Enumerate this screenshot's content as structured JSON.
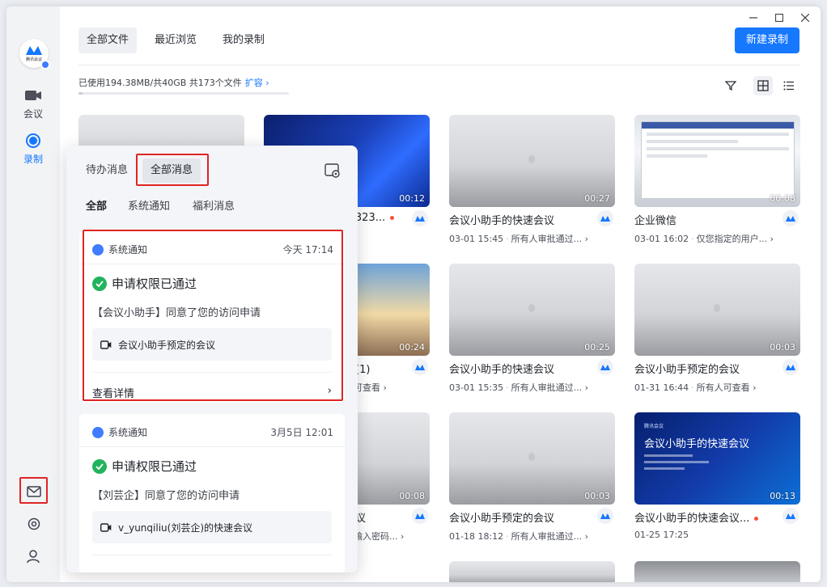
{
  "app": {
    "logo_text": "腾讯会议",
    "brand_color": "#1677ff"
  },
  "sidebar": {
    "items": [
      {
        "label": "会议",
        "icon": "camera-icon"
      },
      {
        "label": "录制",
        "icon": "record-icon"
      }
    ],
    "bottom": [
      {
        "icon": "mail-icon"
      },
      {
        "icon": "settings-icon"
      },
      {
        "icon": "user-icon"
      }
    ]
  },
  "header": {
    "tabs": [
      "全部文件",
      "最近浏览",
      "我的录制"
    ],
    "new_button": "新建录制",
    "storage_text": "已使用194.38MB/共40GB  共173个文件",
    "expand_label": "扩容",
    "storage_used_fraction": 0.005
  },
  "cards": [
    {
      "title": "",
      "meta_left": "",
      "meta_right": "",
      "duration": ""
    },
    {
      "title": "E-323...",
      "meta_left": "",
      "meta_right": "",
      "duration": "00:12",
      "rec": true
    },
    {
      "title": "会议小助手的快速会议",
      "meta_left": "03-01 15:45",
      "meta_right": "所有人审批通过...",
      "duration": "00:27"
    },
    {
      "title": "企业微信",
      "meta_left": "03-01 16:02",
      "meta_right": "仅您指定的用户...",
      "duration": "00:08"
    },
    {
      "title": "件(1)",
      "meta_left": "",
      "meta_right": "人可查看",
      "duration": "00:24"
    },
    {
      "title": "会议小助手的快速会议",
      "meta_left": "03-01 15:35",
      "meta_right": "所有人审批通过...",
      "duration": "00:25"
    },
    {
      "title": "会议小助手预定的会议",
      "meta_left": "01-31 16:44",
      "meta_right": "所有人可查看",
      "duration": "00:03"
    },
    {
      "title": "会议",
      "meta_left": "",
      "meta_right": "人输入密码...",
      "duration": "00:08"
    },
    {
      "title": "会议小助手预定的会议",
      "meta_left": "01-18 18:12",
      "meta_right": "所有人审批通过...",
      "duration": "00:03"
    },
    {
      "title": "会议小助手的快速会议...",
      "meta_left": "01-25 17:25",
      "meta_right": "",
      "duration": "00:13",
      "rec": true,
      "promo_title": "会议小助手的快速会议",
      "promo_brand": "腾讯会议"
    }
  ],
  "popup": {
    "tabs": [
      "待办消息",
      "全部消息"
    ],
    "subtabs": [
      "全部",
      "系统通知",
      "福利消息"
    ],
    "messages": [
      {
        "category": "系统通知",
        "time": "今天 17:14",
        "status": "申请权限已通过",
        "body": "【会议小助手】同意了您的访问申请",
        "meeting": "会议小助手预定的会议",
        "detail": "查看详情"
      },
      {
        "category": "系统通知",
        "time": "3月5日 12:01",
        "status": "申请权限已通过",
        "body": "【刘芸企】同意了您的访问申请",
        "meeting": "v_yunqiliu(刘芸企)的快速会议"
      }
    ]
  }
}
